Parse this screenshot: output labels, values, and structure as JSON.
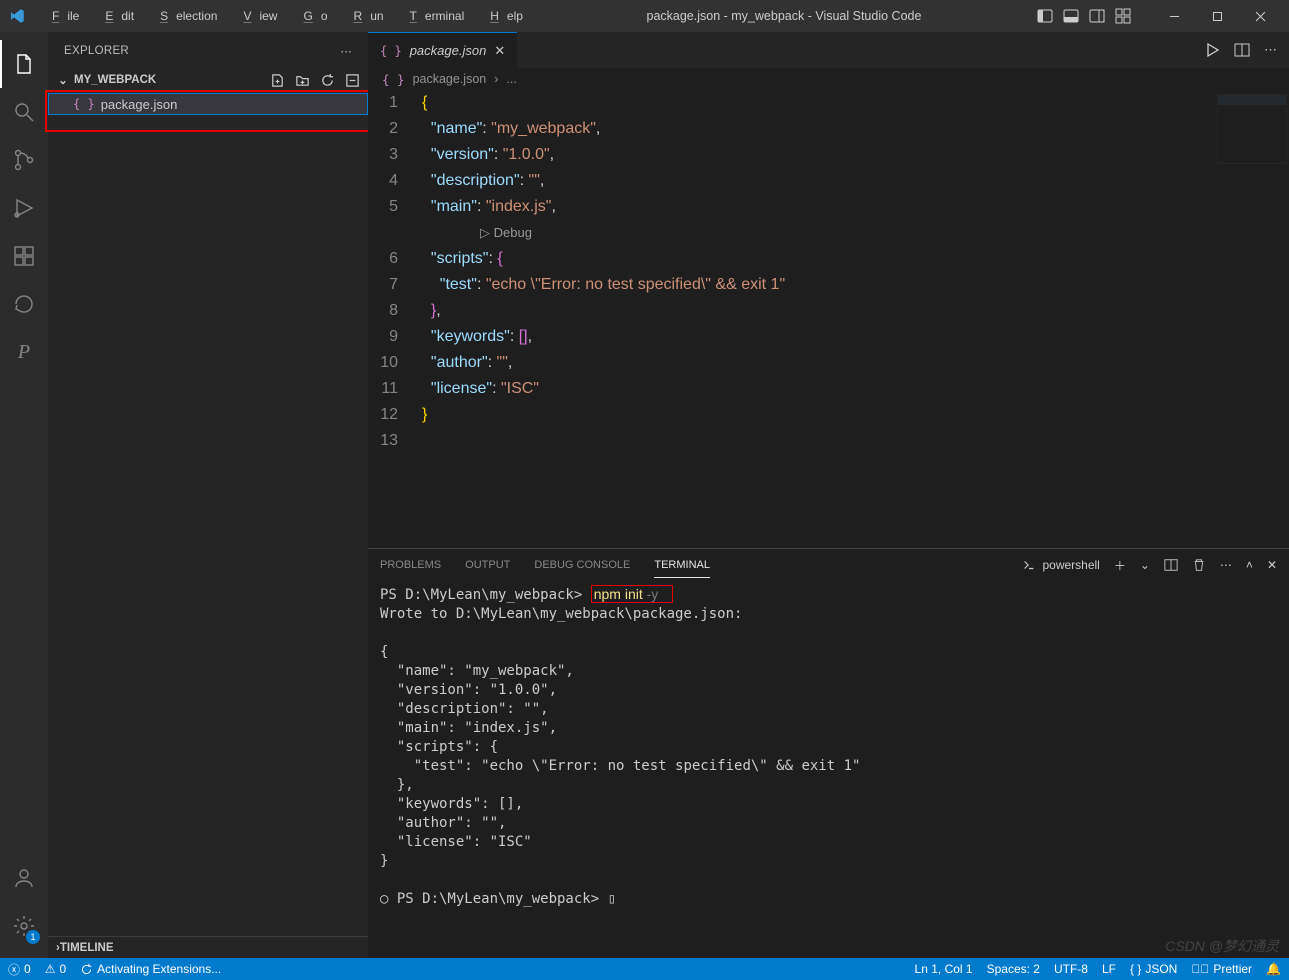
{
  "title": "package.json - my_webpack - Visual Studio Code",
  "menu": [
    "File",
    "Edit",
    "Selection",
    "View",
    "Go",
    "Run",
    "Terminal",
    "Help"
  ],
  "sidebar": {
    "title": "EXPLORER",
    "project": "MY_WEBPACK",
    "files": [
      {
        "name": "package.json"
      }
    ],
    "timeline": "TIMELINE"
  },
  "tab": {
    "name": "package.json"
  },
  "breadcrumb": {
    "file": "package.json",
    "more": "..."
  },
  "code": {
    "lines": [
      {
        "n": 1,
        "t": "brace_open"
      },
      {
        "n": 2,
        "t": "kv",
        "k": "name",
        "v": "my_webpack",
        "c": true
      },
      {
        "n": 3,
        "t": "kv",
        "k": "version",
        "v": "1.0.0",
        "c": true
      },
      {
        "n": 4,
        "t": "kv",
        "k": "description",
        "v": "",
        "c": true
      },
      {
        "n": 5,
        "t": "kv",
        "k": "main",
        "v": "index.js",
        "c": true
      },
      {
        "n": "debug",
        "t": "debug",
        "label": "Debug"
      },
      {
        "n": 6,
        "t": "obj_open",
        "k": "scripts"
      },
      {
        "n": 7,
        "t": "kv2",
        "k": "test",
        "v": "echo \\\"Error: no test specified\\\" && exit 1"
      },
      {
        "n": 8,
        "t": "obj_close",
        "c": true
      },
      {
        "n": 9,
        "t": "arr",
        "k": "keywords",
        "c": true
      },
      {
        "n": 10,
        "t": "kv",
        "k": "author",
        "v": "",
        "c": true
      },
      {
        "n": 11,
        "t": "kv",
        "k": "license",
        "v": "ISC"
      },
      {
        "n": 12,
        "t": "brace_close"
      },
      {
        "n": 13,
        "t": "empty"
      }
    ]
  },
  "panel": {
    "tabs": [
      "PROBLEMS",
      "OUTPUT",
      "DEBUG CONSOLE",
      "TERMINAL"
    ],
    "active": 3,
    "shell": "powershell",
    "terminal_prompt1": "PS D:\\MyLean\\my_webpack>",
    "terminal_cmd": "npm init",
    "terminal_flag": "-y",
    "terminal_output": "Wrote to D:\\MyLean\\my_webpack\\package.json:\n\n{\n  \"name\": \"my_webpack\",\n  \"version\": \"1.0.0\",\n  \"description\": \"\",\n  \"main\": \"index.js\",\n  \"scripts\": {\n    \"test\": \"echo \\\"Error: no test specified\\\" && exit 1\"\n  },\n  \"keywords\": [],\n  \"author\": \"\",\n  \"license\": \"ISC\"\n}\n\n",
    "terminal_prompt2": "PS D:\\MyLean\\my_webpack>"
  },
  "status": {
    "errors": "0",
    "warnings": "0",
    "activating": "Activating Extensions...",
    "lncol": "Ln 1, Col 1",
    "spaces": "Spaces: 2",
    "enc": "UTF-8",
    "eol": "LF",
    "lang": "JSON",
    "prettier": "Prettier",
    "bell": ""
  },
  "watermark": "CSDN @梦幻通灵"
}
